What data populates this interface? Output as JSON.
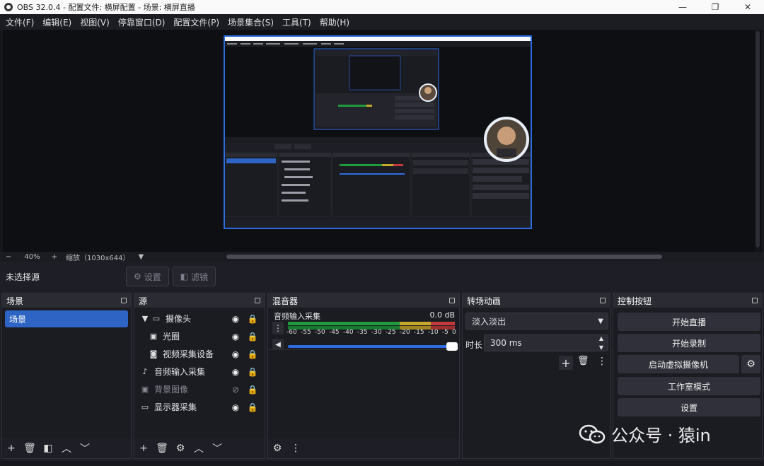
{
  "window": {
    "title": "OBS 32.0.4 - 配置文件: 横屏配置 - 场景: 横屏直播",
    "minimize": "—",
    "maximize": "❐",
    "close": "✕"
  },
  "menu": [
    "文件(F)",
    "编辑(E)",
    "视图(V)",
    "停靠窗口(D)",
    "配置文件(P)",
    "场景集合(S)",
    "工具(T)",
    "帮助(H)"
  ],
  "zoom": {
    "minus": "−",
    "level": "40%",
    "plus": "+",
    "scale_label": "缩放（1030x644）"
  },
  "source_toolbar": {
    "no_source": "未选择源",
    "settings": "设置",
    "filters": "滤镜"
  },
  "scenes": {
    "title": "场景",
    "items": [
      "场景"
    ]
  },
  "sources": {
    "title": "源",
    "items": [
      {
        "name": "摄像头",
        "icon": "folder-icon",
        "indent": 0,
        "group": true,
        "visible": true
      },
      {
        "name": "光圈",
        "icon": "image-icon",
        "indent": 1,
        "visible": true
      },
      {
        "name": "视频采集设备",
        "icon": "camera-icon",
        "indent": 1,
        "visible": true
      },
      {
        "name": "音频输入采集",
        "icon": "microphone-icon",
        "indent": 0,
        "visible": true
      },
      {
        "name": "背景图像",
        "icon": "image-icon",
        "indent": 0,
        "visible": false
      },
      {
        "name": "显示器采集",
        "icon": "monitor-icon",
        "indent": 0,
        "visible": true
      }
    ]
  },
  "mixer": {
    "title": "混音器",
    "channel": "音频输入采集",
    "db": "0.0 dB",
    "scale": [
      "-60",
      "-55",
      "-50",
      "-45",
      "-40",
      "-35",
      "-30",
      "-25",
      "-20",
      "-15",
      "-10",
      "-5",
      "0"
    ],
    "volume": 0.88
  },
  "transitions": {
    "title": "转场动画",
    "selected": "淡入淡出",
    "duration_label": "时长",
    "duration": "300 ms"
  },
  "controls": {
    "title": "控制按钮",
    "start_stream": "开始直播",
    "start_record": "开始录制",
    "virtual_cam": "启动虚拟摄像机",
    "studio_mode": "工作室模式",
    "settings": "设置"
  },
  "watermark": {
    "text": "公众号 · 猿in"
  },
  "colors": {
    "accent": "#2e64c4",
    "meter_green": "#1f9a3c",
    "meter_yellow": "#c8a82a",
    "meter_red": "#c43a3a"
  }
}
